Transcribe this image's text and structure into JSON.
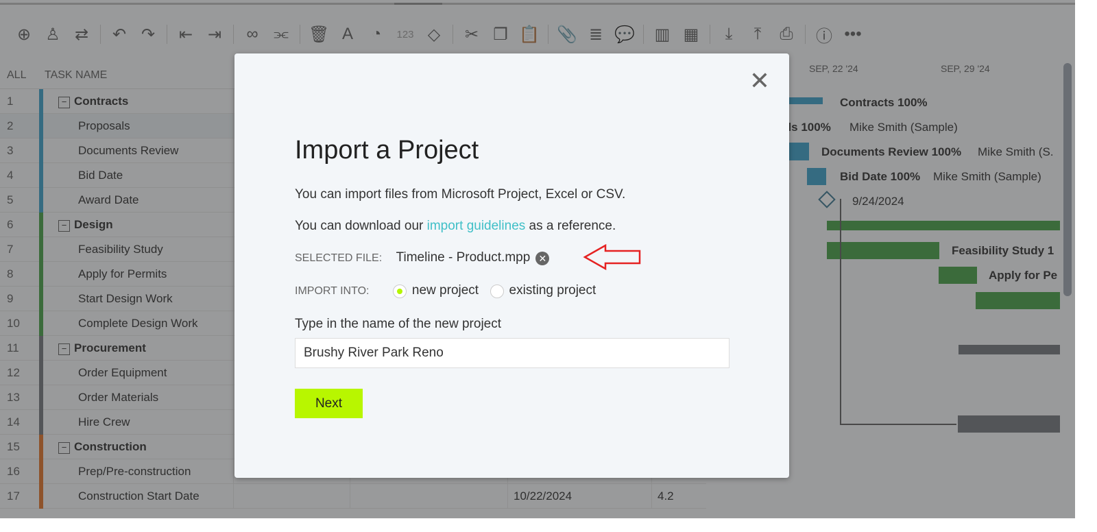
{
  "toolbar": {
    "icons": [
      "add-icon",
      "user-icon",
      "swap-icon",
      "undo-icon",
      "redo-icon",
      "outdent-icon",
      "indent-icon",
      "link-icon",
      "unlink-icon",
      "trash-icon",
      "text-color-icon",
      "fill-icon",
      "number-icon",
      "milestone-icon",
      "cut-icon",
      "copy-icon",
      "paste-icon",
      "attachment-icon",
      "notes-icon",
      "comment-icon",
      "columns-icon",
      "grid-icon",
      "import-icon",
      "export-icon",
      "print-icon",
      "info-icon",
      "more-icon"
    ],
    "number_label": "123"
  },
  "grid": {
    "header": {
      "all": "ALL",
      "task_name": "TASK NAME"
    },
    "rows": [
      {
        "n": "1",
        "name": "Contracts",
        "group": true,
        "color": "#2e9bc6"
      },
      {
        "n": "2",
        "name": "Proposals",
        "color": "#2e9bc6"
      },
      {
        "n": "3",
        "name": "Documents Review",
        "color": "#2e9bc6"
      },
      {
        "n": "4",
        "name": "Bid Date",
        "color": "#2e9bc6"
      },
      {
        "n": "5",
        "name": "Award Date",
        "color": "#2e9bc6"
      },
      {
        "n": "6",
        "name": "Design",
        "group": true,
        "color": "#3a9a3a"
      },
      {
        "n": "7",
        "name": "Feasibility Study",
        "color": "#3a9a3a"
      },
      {
        "n": "8",
        "name": "Apply for Permits",
        "color": "#3a9a3a"
      },
      {
        "n": "9",
        "name": "Start Design Work",
        "color": "#3a9a3a"
      },
      {
        "n": "10",
        "name": "Complete Design Work",
        "color": "#3a9a3a"
      },
      {
        "n": "11",
        "name": "Procurement",
        "group": true,
        "color": "#6b6e75"
      },
      {
        "n": "12",
        "name": "Order Equipment",
        "color": "#6b6e75"
      },
      {
        "n": "13",
        "name": "Order Materials",
        "color": "#6b6e75"
      },
      {
        "n": "14",
        "name": "Hire Crew",
        "color": "#6b6e75"
      },
      {
        "n": "15",
        "name": "Construction",
        "group": true,
        "color": "#e06a1b"
      },
      {
        "n": "16",
        "name": "Prep/Pre-construction",
        "color": "#e06a1b"
      },
      {
        "n": "17",
        "name": "Construction Start Date",
        "color": "#e06a1b",
        "date": "10/22/2024",
        "val": "4.2"
      }
    ]
  },
  "gantt": {
    "dates": [
      "SEP, 22 '24",
      "SEP, 29 '24"
    ],
    "labels": {
      "contracts": "Contracts  100%",
      "proposals": "als  100%",
      "proposals_owner": "Mike Smith (Sample)",
      "docs": "Documents Review  100%",
      "docs_owner": "Mike Smith (S.",
      "bid": "Bid Date  100%",
      "bid_owner": "Mike Smith (Sample)",
      "award": "9/24/2024",
      "feas": "Feasibility Study  1",
      "permits": "Apply for Pe"
    }
  },
  "modal": {
    "title": "Import a Project",
    "line1": "You can import files from Microsoft Project, Excel or CSV.",
    "line2_pre": "You can download our ",
    "line2_link": "import guidelines",
    "line2_post": " as a reference.",
    "selected_label": "SELECTED FILE:",
    "selected_file": "Timeline - Product.mpp",
    "import_label": "IMPORT INTO:",
    "opt_new": "new project",
    "opt_existing": "existing project",
    "selected_option": "new project",
    "name_label": "Type in the name of the new project",
    "name_value": "Brushy River Park Reno",
    "next": "Next",
    "close": "✕"
  }
}
